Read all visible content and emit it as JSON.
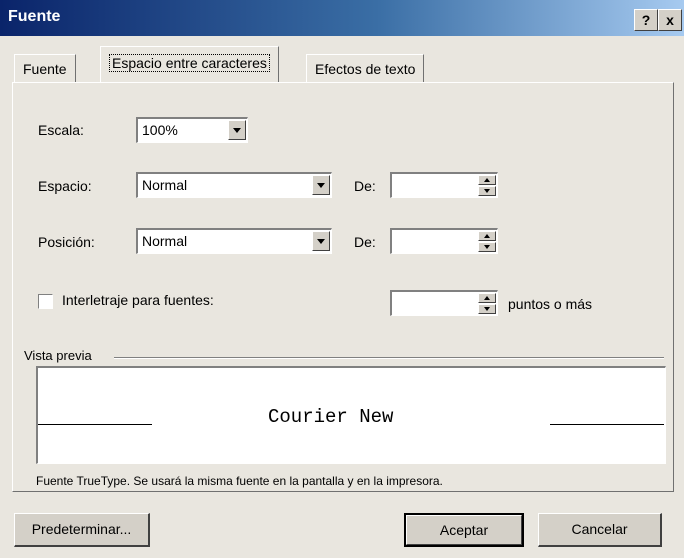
{
  "window": {
    "title": "Fuente",
    "help_label": "?",
    "close_label": "x"
  },
  "tabs": [
    {
      "label": "Fuente",
      "active": false
    },
    {
      "label": "Espacio entre caracteres",
      "active": true
    },
    {
      "label": "Efectos de texto",
      "active": false
    }
  ],
  "fields": {
    "escala": {
      "label": "Escala:",
      "value": "100%"
    },
    "espacio": {
      "label": "Espacio:",
      "value": "Normal",
      "de_label": "De:",
      "de_value": ""
    },
    "posicion": {
      "label": "Posición:",
      "value": "Normal",
      "de_label": "De:",
      "de_value": ""
    },
    "interletraje": {
      "label": "Interletraje para fuentes:",
      "checked": false,
      "value": "",
      "suffix": "puntos o más"
    }
  },
  "preview": {
    "group_label": "Vista previa",
    "sample_text": "Courier New",
    "note": "Fuente TrueType. Se usará la misma fuente en la pantalla y en la impresora."
  },
  "buttons": {
    "default": "Predeterminar...",
    "ok": "Aceptar",
    "cancel": "Cancelar"
  }
}
